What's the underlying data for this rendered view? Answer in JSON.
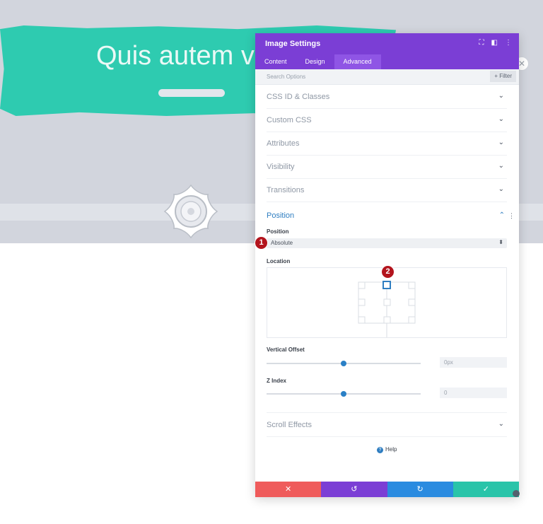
{
  "canvas": {
    "heading": "Quis autem v"
  },
  "panel": {
    "title": "Image Settings",
    "tabs": [
      {
        "label": "Content"
      },
      {
        "label": "Design"
      },
      {
        "label": "Advanced"
      }
    ],
    "search_placeholder": "Search Options",
    "filter_label": "+ Filter",
    "sections": [
      {
        "label": "CSS ID & Classes"
      },
      {
        "label": "Custom CSS"
      },
      {
        "label": "Attributes"
      },
      {
        "label": "Visibility"
      },
      {
        "label": "Transitions"
      }
    ],
    "position_section": {
      "label": "Position",
      "position_field_label": "Position",
      "position_value": "Absolute",
      "location_label": "Location",
      "vertical_offset_label": "Vertical Offset",
      "vertical_offset_value": "0px",
      "vertical_offset_level": 0.5,
      "z_index_label": "Z Index",
      "z_index_value": "0",
      "z_index_level": 0.5
    },
    "scroll_effects_label": "Scroll Effects",
    "help_label": "Help"
  },
  "markers": [
    {
      "number": "1"
    },
    {
      "number": "2"
    }
  ],
  "colors": {
    "header": "#7b3ed5",
    "accent_blue": "#2f7ec1",
    "teal": "#2ecbb0",
    "cancel": "#ef5b5b",
    "undo": "#7b3ed5",
    "redo": "#2a8be0",
    "save": "#29c4a9"
  }
}
